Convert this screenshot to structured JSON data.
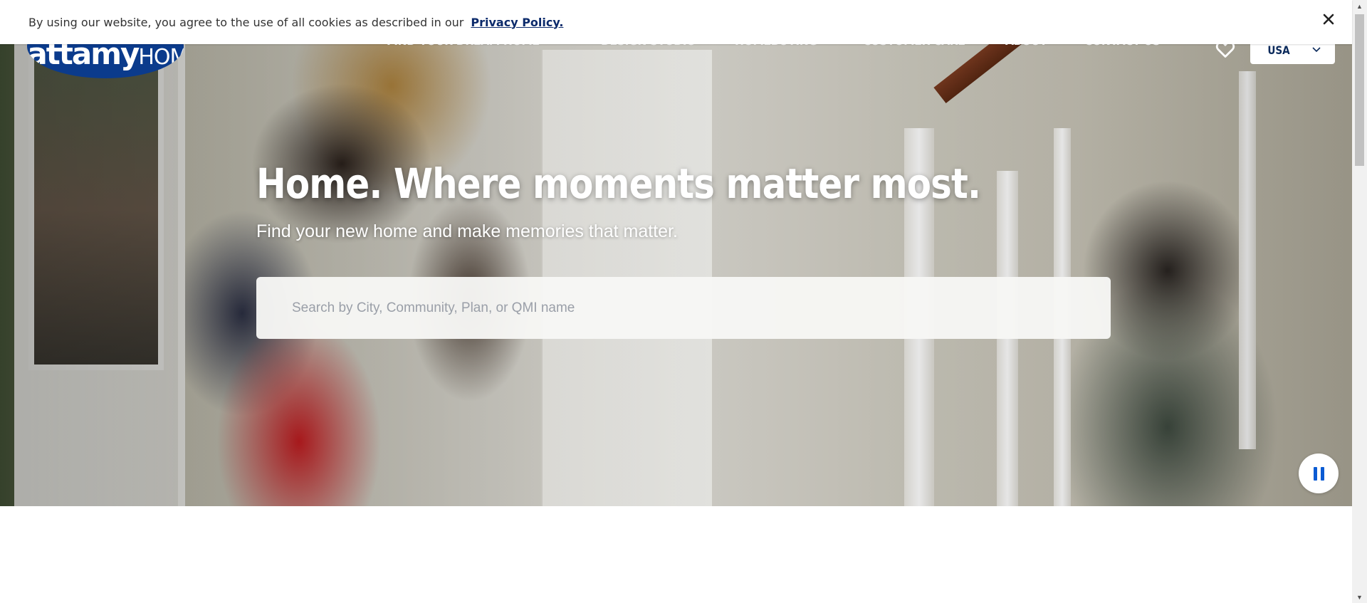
{
  "cookie_banner": {
    "text": "By using our website, you agree to the use of all cookies as described in our",
    "link_label": "Privacy Policy.",
    "close_icon": "close-icon"
  },
  "header": {
    "logo": {
      "text_main": "mattamy",
      "text_suffix": "HOMES"
    },
    "nav": [
      {
        "label": "FIND YOUR DREAM HOME",
        "has_dropdown": true
      },
      {
        "label": "DESIGN STUDIO",
        "has_dropdown": false
      },
      {
        "label": "HOMEBUYING",
        "has_dropdown": true
      },
      {
        "label": "CUSTOMER CARE",
        "has_dropdown": false
      },
      {
        "label": "ABOUT",
        "has_dropdown": true
      },
      {
        "label": "CONTACT US",
        "has_dropdown": false
      }
    ],
    "favorites_icon": "heart-icon",
    "region": {
      "value": "USA"
    }
  },
  "hero": {
    "title": "Home. Where moments matter most.",
    "subtitle": "Find your new home and make memories that matter.",
    "search": {
      "placeholder": "Search by City, Community, Plan, or QMI name",
      "value": ""
    },
    "video_control_icon": "pause-icon"
  },
  "colors": {
    "brand_blue": "#0b3b8c",
    "link_navy": "#0b2a6b",
    "pause_blue": "#0b5bd3"
  }
}
